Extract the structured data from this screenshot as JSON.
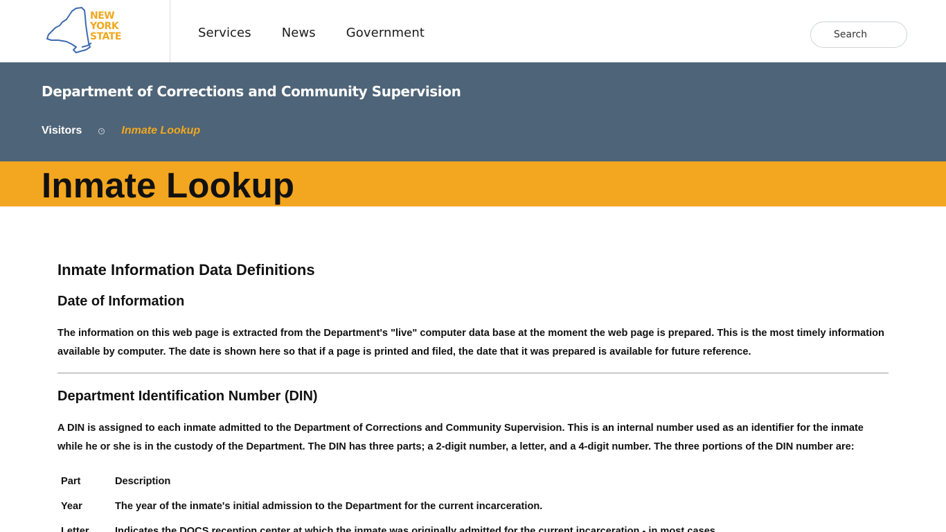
{
  "header": {
    "logo_lines": [
      "NEW",
      "YORK",
      "STATE"
    ],
    "nav": [
      "Services",
      "News",
      "Government"
    ],
    "search_placeholder": "Search"
  },
  "agency": {
    "title": "Department of Corrections and Community Supervision",
    "breadcrumb": {
      "parent": "Visitors",
      "current": "Inmate Lookup"
    }
  },
  "page_title": "Inmate Lookup",
  "content": {
    "heading": "Inmate Information Data Definitions",
    "date_section": {
      "heading": "Date of Information",
      "text": "The information on this web page is extracted from the Department's \"live\" computer data base at the moment the web page is prepared. This is the most timely information available by computer. The date is shown here so that if a page is printed and filed, the date that it was prepared is available for future reference."
    },
    "din_section": {
      "heading": "Department Identification Number (DIN)",
      "text": "A DIN is assigned to each inmate admitted to the Department of Corrections and Community Supervision. This is an internal number used as an identifier for the inmate while he or she is in the custody of the Department. The DIN has three parts; a 2-digit number, a letter, and a 4-digit number. The three portions of the DIN number are:",
      "table": {
        "headers": [
          "Part",
          "Description"
        ],
        "rows": [
          [
            "Year",
            "The year of the inmate's initial admission to the Department for the current incarceration."
          ],
          [
            "Letter",
            "Indicates the DOCS reception center at which the inmate was originally admitted for the current incarceration - in most cases."
          ]
        ]
      }
    }
  },
  "colors": {
    "agency_band": "#4e6478",
    "title_band": "#f3a61f",
    "accent": "#f0a81f"
  }
}
